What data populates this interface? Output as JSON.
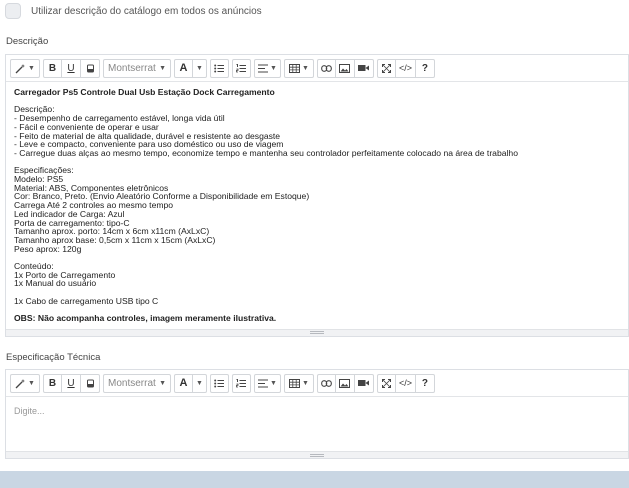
{
  "catalog_option": {
    "label": "Utilizar descrição do catálogo em todos os anúncios",
    "checked": false
  },
  "toolbar": {
    "font_select": "Montserrat",
    "bold": "B",
    "underline": "U",
    "font_color": "A",
    "help": "?",
    "code": "</>"
  },
  "descricao": {
    "label": "Descrição",
    "lines": [
      {
        "text": "Carregador Ps5 Controle Dual Usb Estação Dock Carregamento",
        "bold": true
      },
      {
        "text": "",
        "bold": false
      },
      {
        "text": "Descrição:",
        "bold": false
      },
      {
        "text": "- Desempenho de carregamento estável, longa vida útil",
        "bold": false
      },
      {
        "text": "- Fácil e conveniente de operar e usar",
        "bold": false
      },
      {
        "text": "- Feito de material de alta qualidade, durável e resistente ao desgaste",
        "bold": false
      },
      {
        "text": "- Leve e compacto, conveniente para uso doméstico ou uso de viagem",
        "bold": false
      },
      {
        "text": "- Carregue duas alças ao mesmo tempo, economize tempo e mantenha seu controlador perfeitamente colocado na área de trabalho",
        "bold": false
      },
      {
        "text": "",
        "bold": false
      },
      {
        "text": "Especificações:",
        "bold": false
      },
      {
        "text": "Modelo: PS5",
        "bold": false
      },
      {
        "text": "Material: ABS, Componentes eletrônicos",
        "bold": false
      },
      {
        "text": "Cor: Branco, Preto. (Envio Aleatório Conforme a Disponibilidade em Estoque)",
        "bold": false
      },
      {
        "text": "Carrega Até 2 controles ao mesmo tempo",
        "bold": false
      },
      {
        "text": "Led indicador de Carga: Azul",
        "bold": false
      },
      {
        "text": "Porta de carregamento: tipo-C",
        "bold": false
      },
      {
        "text": "Tamanho aprox. porto: 14cm x 6cm x11cm (AxLxC)",
        "bold": false
      },
      {
        "text": "Tamanho aprox base: 0,5cm x 11cm x 15cm (AxLxC)",
        "bold": false
      },
      {
        "text": "Peso aprox: 120g",
        "bold": false
      },
      {
        "text": "",
        "bold": false
      },
      {
        "text": "Conteúdo:",
        "bold": false
      },
      {
        "text": "1x Porto de Carregamento",
        "bold": false
      },
      {
        "text": "1x Manual do usuário",
        "bold": false
      },
      {
        "text": "",
        "bold": false
      },
      {
        "text": "1x Cabo de carregamento USB tipo C",
        "bold": false
      },
      {
        "text": "",
        "bold": false
      },
      {
        "text": "OBS: Não acompanha controles, imagem meramente ilustrativa.",
        "bold": true
      }
    ]
  },
  "especificacao": {
    "label": "Especificação Técnica",
    "placeholder": "Digite..."
  }
}
